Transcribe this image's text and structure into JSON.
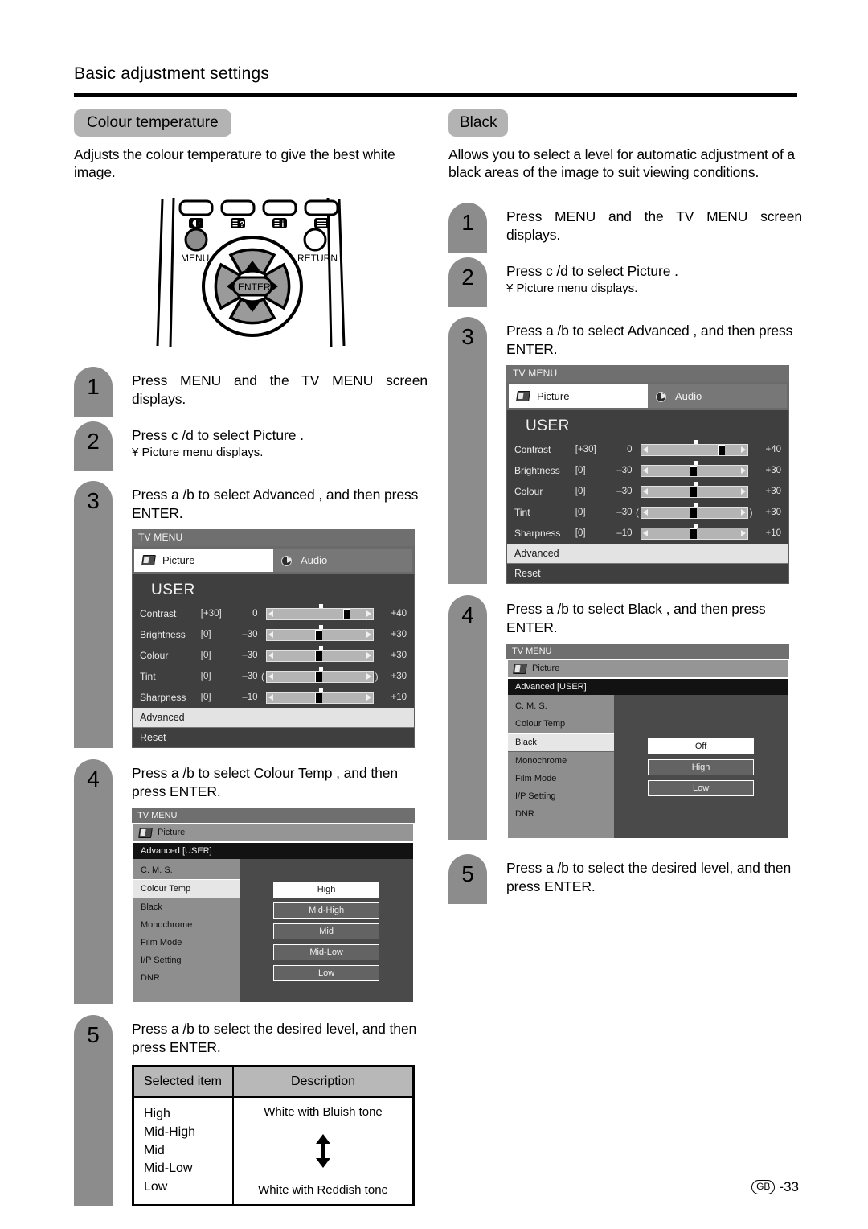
{
  "page": {
    "header_title": "Basic adjustment settings",
    "footer_region": "GB",
    "footer_page": "-33"
  },
  "remote": {
    "label_menu": "MENU",
    "label_return": "RETURN",
    "label_enter": "ENTER",
    "top_buttons": [
      "picture-mode-icon",
      "help-icon",
      "info-icon",
      "menu-list-icon"
    ]
  },
  "left_section": {
    "chip": "Colour temperature",
    "intro": "Adjusts the colour temperature to give the best white image.",
    "steps": [
      {
        "num": "1",
        "text": "Press MENU and the TV MENU screen displays.",
        "sub": ""
      },
      {
        "num": "2",
        "text": "Press c /d  to select  Picture .",
        "sub": "¥ Picture menu displays."
      },
      {
        "num": "3",
        "text": "Press a /b  to select  Advanced , and then press ENTER.",
        "sub": ""
      },
      {
        "num": "4",
        "text": "Press a /b  to select  Colour Temp , and then press ENTER.",
        "sub": ""
      },
      {
        "num": "5",
        "text": "Press a /b  to select the desired level, and then press ENTER.",
        "sub": ""
      }
    ],
    "advanced_menu": {
      "bar": "TV MENU",
      "picture": "Picture",
      "advanced_header": "Advanced [USER]",
      "items": [
        "C. M. S.",
        "Colour Temp",
        "Black",
        "Monochrome",
        "Film Mode",
        "I/P Setting",
        "DNR"
      ],
      "selected_item": "Colour Temp",
      "options": [
        "High",
        "Mid-High",
        "Mid",
        "Mid-Low",
        "Low"
      ],
      "selected_option": "High"
    },
    "table": {
      "headers": [
        "Selected item",
        "Description"
      ],
      "items": [
        "High",
        "Mid-High",
        "Mid",
        "Mid-Low",
        "Low"
      ],
      "desc_top": "White with Bluish tone",
      "desc_bottom": "White with Reddish tone"
    }
  },
  "right_section": {
    "chip": "Black",
    "intro": "Allows you to select a level for automatic adjustment of a black areas of the image to suit viewing conditions.",
    "steps": [
      {
        "num": "1",
        "text": "Press MENU and the TV MENU screen displays.",
        "sub": ""
      },
      {
        "num": "2",
        "text": "Press c /d  to select  Picture .",
        "sub": "¥ Picture menu displays."
      },
      {
        "num": "3",
        "text": "Press a /b  to select  Advanced , and then press ENTER.",
        "sub": ""
      },
      {
        "num": "4",
        "text": "Press a /b  to select  Black , and then press ENTER.",
        "sub": ""
      },
      {
        "num": "5",
        "text": "Press a /b  to select the desired level, and then press ENTER.",
        "sub": ""
      }
    ],
    "advanced_menu": {
      "bar": "TV MENU",
      "picture": "Picture",
      "advanced_header": "Advanced [USER]",
      "items": [
        "C. M. S.",
        "Colour Temp",
        "Black",
        "Monochrome",
        "Film Mode",
        "I/P Setting",
        "DNR"
      ],
      "selected_item": "Black",
      "options": [
        "Off",
        "High",
        "Low"
      ],
      "selected_option": "Off"
    }
  },
  "user_menu": {
    "bar": "TV MENU",
    "tab_picture": "Picture",
    "tab_audio": "Audio",
    "title": "USER",
    "rows": [
      {
        "name": "Contrast",
        "value": "[+30]",
        "min": "0",
        "max": "+40",
        "thumb_pct": 74,
        "tick_pct": 50,
        "brackets": false
      },
      {
        "name": "Brightness",
        "value": "[0]",
        "min": "–30",
        "max": "+30",
        "thumb_pct": 48,
        "tick_pct": 50,
        "brackets": false
      },
      {
        "name": "Colour",
        "value": "[0]",
        "min": "–30",
        "max": "+30",
        "thumb_pct": 48,
        "tick_pct": 50,
        "brackets": false
      },
      {
        "name": "Tint",
        "value": "[0]",
        "min": "–30",
        "max": "+30",
        "thumb_pct": 48,
        "tick_pct": 50,
        "brackets": true
      },
      {
        "name": "Sharpness",
        "value": "[0]",
        "min": "–10",
        "max": "+10",
        "thumb_pct": 48,
        "tick_pct": 50,
        "brackets": false
      }
    ],
    "advanced_label": "Advanced",
    "reset_label": "Reset"
  }
}
